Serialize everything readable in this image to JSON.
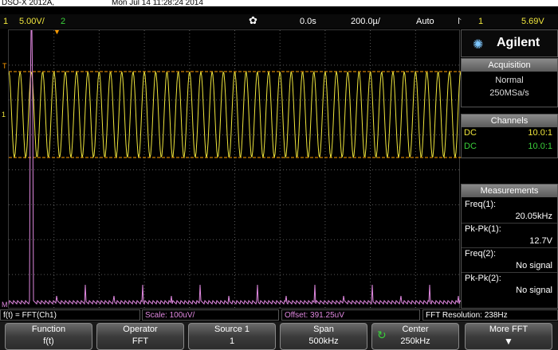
{
  "title_bar": {
    "model": "DSO-X 2012A,",
    "datetime": "Mon Jul 14 11:28:24 2014"
  },
  "status_bar": {
    "ch1_number": "1",
    "ch1_scale": "5.00V/",
    "ch2_number": "2",
    "time_delay": "0.0s",
    "time_scale": "200.0µ/",
    "trigger_mode": "Auto",
    "trigger_number": "1",
    "trigger_level": "5.69V"
  },
  "brand": "Agilent",
  "acquisition": {
    "heading": "Acquisition",
    "mode": "Normal",
    "rate": "250MSa/s"
  },
  "channels": {
    "heading": "Channels",
    "rows": [
      {
        "coupling": "DC",
        "probe": "10.0:1"
      },
      {
        "coupling": "DC",
        "probe": "10.0:1"
      }
    ]
  },
  "measurements": {
    "heading": "Measurements",
    "items": [
      {
        "label": "Freq(1):",
        "value": "20.05kHz"
      },
      {
        "label": "Pk-Pk(1):",
        "value": "12.7V"
      },
      {
        "label": "Freq(2):",
        "value": "No signal"
      },
      {
        "label": "Pk-Pk(2):",
        "value": "No signal"
      }
    ]
  },
  "fft_bar": {
    "function": "f(t) = FFT(Ch1)",
    "scale": "Scale: 100uV/",
    "offset": "Offset: 391.25uV",
    "resolution": "FFT Resolution: 238Hz"
  },
  "softkeys": [
    {
      "label": "Function",
      "value": "f(t)"
    },
    {
      "label": "Operator",
      "value": "FFT"
    },
    {
      "label": "Source 1",
      "value": "1"
    },
    {
      "label": "Span",
      "value": "500kHz"
    },
    {
      "label": "Center",
      "value": "250kHz"
    },
    {
      "label": "More FFT",
      "value": ""
    }
  ],
  "markers": {
    "trigger_marker": "T",
    "ch1_marker": "1",
    "math_marker": "M"
  },
  "colors": {
    "ch1": "#f0e63c",
    "ch2": "#3ad13a",
    "math": "#e088e0",
    "cursor": "#ff9c00",
    "grid": "#5a5a5a",
    "softkey_bg": "#4a4a4a"
  }
}
